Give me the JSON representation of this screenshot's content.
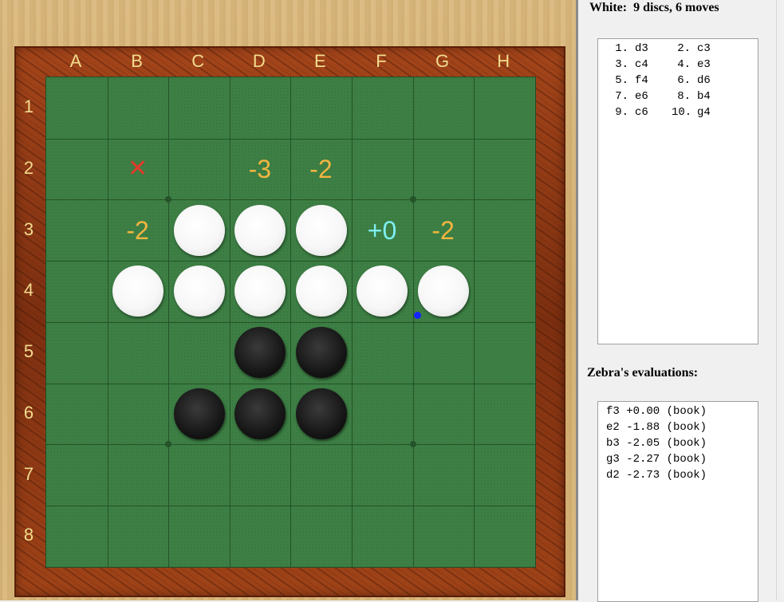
{
  "board": {
    "columns": [
      "A",
      "B",
      "C",
      "D",
      "E",
      "F",
      "G",
      "H"
    ],
    "rows": [
      "1",
      "2",
      "3",
      "4",
      "5",
      "6",
      "7",
      "8"
    ],
    "discs": [
      {
        "square": "c3",
        "color": "white"
      },
      {
        "square": "d3",
        "color": "white"
      },
      {
        "square": "e3",
        "color": "white"
      },
      {
        "square": "b4",
        "color": "white"
      },
      {
        "square": "c4",
        "color": "white"
      },
      {
        "square": "d4",
        "color": "white"
      },
      {
        "square": "e4",
        "color": "white"
      },
      {
        "square": "f4",
        "color": "white"
      },
      {
        "square": "g4",
        "color": "white"
      },
      {
        "square": "d5",
        "color": "black"
      },
      {
        "square": "e5",
        "color": "black"
      },
      {
        "square": "c6",
        "color": "black"
      },
      {
        "square": "d6",
        "color": "black"
      },
      {
        "square": "e6",
        "color": "black"
      }
    ],
    "evaluations": [
      {
        "square": "d2",
        "text": "-3",
        "color": "#f2b541"
      },
      {
        "square": "e2",
        "text": "-2",
        "color": "#f2b541"
      },
      {
        "square": "b3",
        "text": "-2",
        "color": "#f2b541"
      },
      {
        "square": "f3",
        "text": "+0",
        "color": "#7ef0f2"
      },
      {
        "square": "g3",
        "text": "-2",
        "color": "#f2b541"
      }
    ],
    "blocked": [
      {
        "square": "b2",
        "text": "✕",
        "color": "#e23a2a"
      }
    ],
    "last_move_square": "g4",
    "last_move_color": "#1524ff"
  },
  "status": {
    "title": "White:  9 discs, 6 moves"
  },
  "moves": [
    {
      "n1": "1.",
      "m1": "d3",
      "n2": "2.",
      "m2": "c3"
    },
    {
      "n1": "3.",
      "m1": "c4",
      "n2": "4.",
      "m2": "e3"
    },
    {
      "n1": "5.",
      "m1": "f4",
      "n2": "6.",
      "m2": "d6"
    },
    {
      "n1": "7.",
      "m1": "e6",
      "n2": "8.",
      "m2": "b4"
    },
    {
      "n1": "9.",
      "m1": "c6",
      "n2": "10.",
      "m2": "g4"
    }
  ],
  "evaluations_panel": {
    "title": "Zebra's evaluations:",
    "items": [
      "f3 +0.00 (book)",
      "e2 -1.88 (book)",
      "b3 -2.05 (book)",
      "g3 -2.27 (book)",
      "d2 -2.73 (book)"
    ]
  }
}
